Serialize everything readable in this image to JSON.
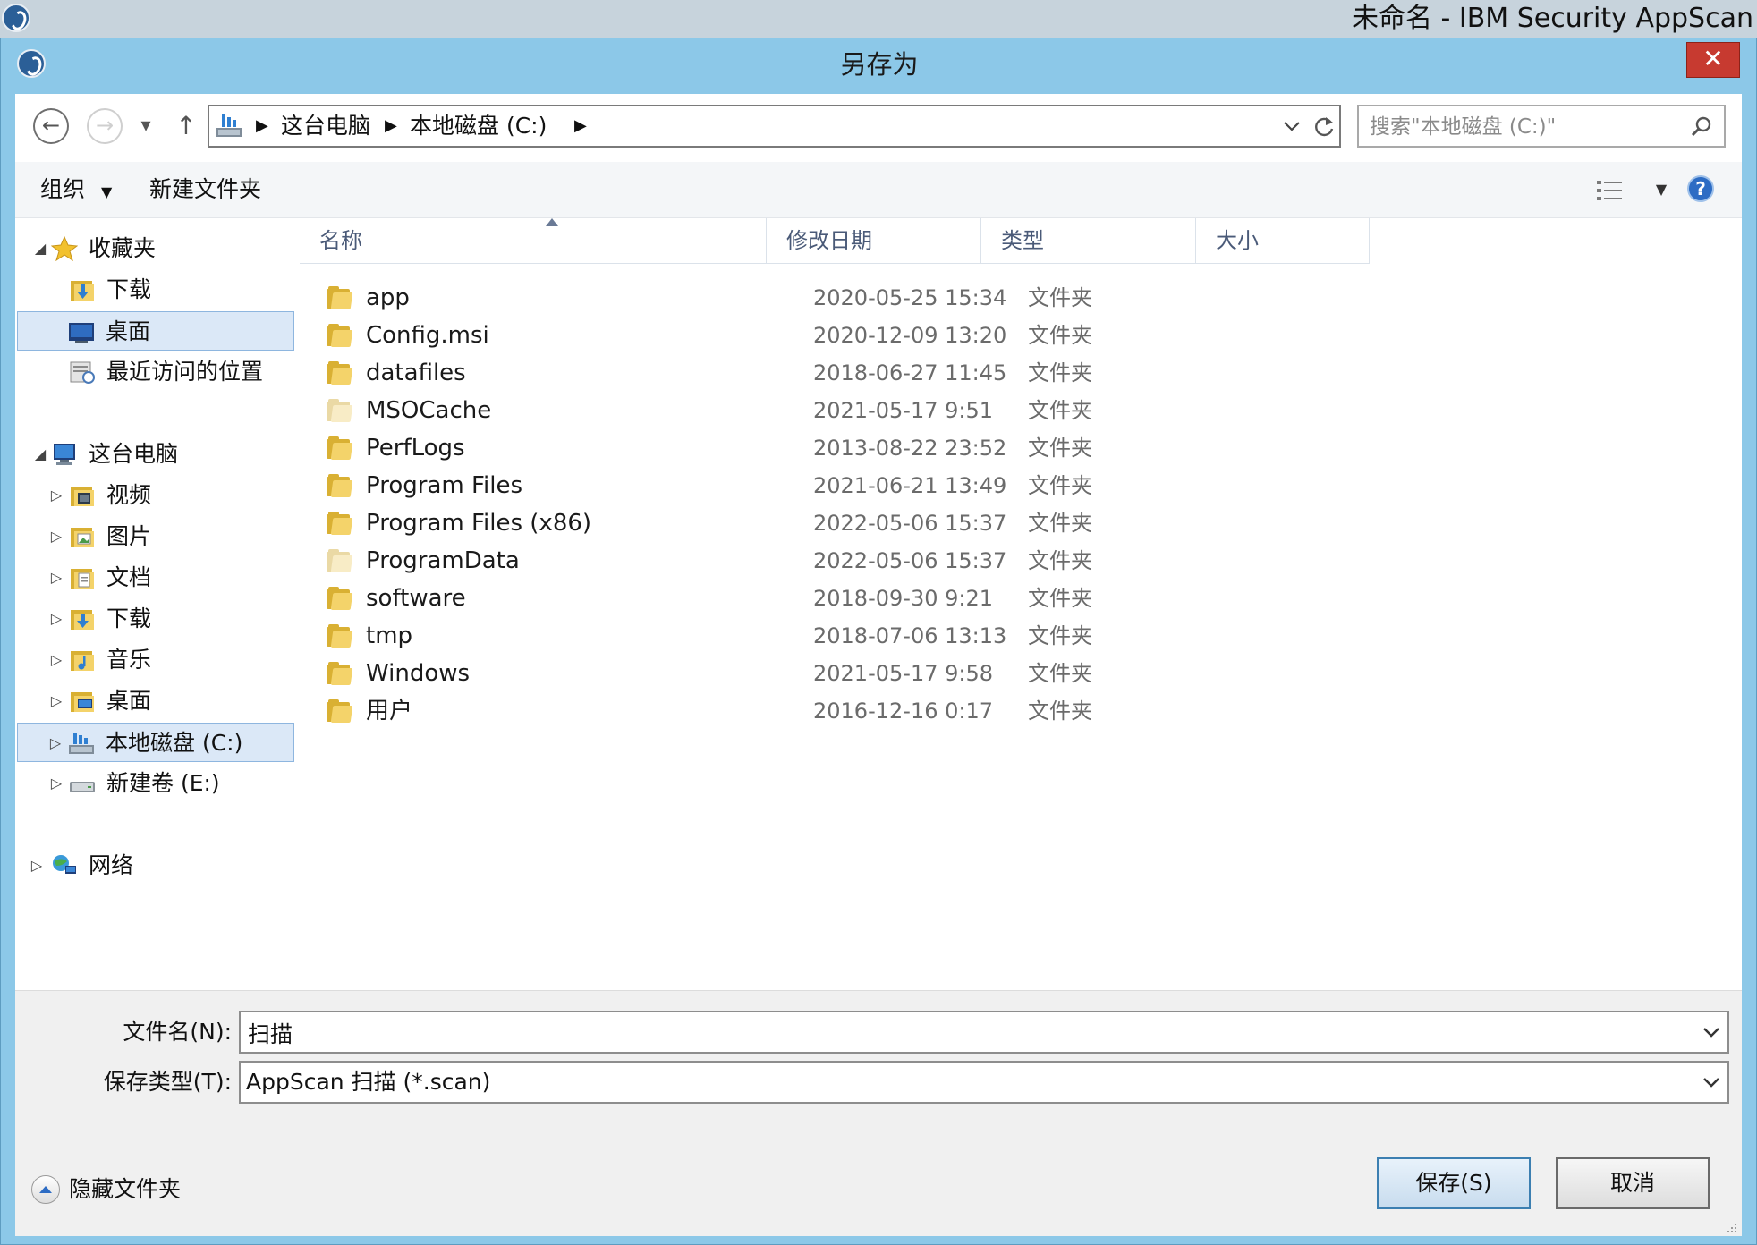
{
  "app": {
    "title": "未命名 - IBM Security AppScan"
  },
  "dialog": {
    "title": "另存为",
    "close_symbol": "✕"
  },
  "address": {
    "crumbs": [
      "这台电脑",
      "本地磁盘 (C:)"
    ],
    "search_placeholder": "搜索\"本地磁盘 (C:)\""
  },
  "toolbar": {
    "organize": "组织",
    "new_folder": "新建文件夹"
  },
  "nav": {
    "favorites": "收藏夹",
    "fav_items": [
      "下载",
      "桌面",
      "最近访问的位置"
    ],
    "this_pc": "这台电脑",
    "pc_items": [
      "视频",
      "图片",
      "文档",
      "下载",
      "音乐",
      "桌面",
      "本地磁盘 (C:)",
      "新建卷 (E:)"
    ],
    "network": "网络"
  },
  "columns": {
    "name": "名称",
    "date": "修改日期",
    "type": "类型",
    "size": "大小"
  },
  "files": [
    {
      "name": "app",
      "date": "2020-05-25 15:34",
      "type": "文件夹"
    },
    {
      "name": "Config.msi",
      "date": "2020-12-09 13:20",
      "type": "文件夹"
    },
    {
      "name": "datafiles",
      "date": "2018-06-27 11:45",
      "type": "文件夹"
    },
    {
      "name": "MSOCache",
      "date": "2021-05-17 9:51",
      "type": "文件夹"
    },
    {
      "name": "PerfLogs",
      "date": "2013-08-22 23:52",
      "type": "文件夹"
    },
    {
      "name": "Program Files",
      "date": "2021-06-21 13:49",
      "type": "文件夹"
    },
    {
      "name": "Program Files (x86)",
      "date": "2022-05-06 15:37",
      "type": "文件夹"
    },
    {
      "name": "ProgramData",
      "date": "2022-05-06 15:37",
      "type": "文件夹"
    },
    {
      "name": "software",
      "date": "2018-09-30 9:21",
      "type": "文件夹"
    },
    {
      "name": "tmp",
      "date": "2018-07-06 13:13",
      "type": "文件夹"
    },
    {
      "name": "Windows",
      "date": "2021-05-17 9:58",
      "type": "文件夹"
    },
    {
      "name": "用户",
      "date": "2016-12-16 0:17",
      "type": "文件夹"
    }
  ],
  "form": {
    "filename_label": "文件名(N):",
    "filename_value": "扫描",
    "filetype_label": "保存类型(T):",
    "filetype_value": "AppScan 扫描 (*.scan)"
  },
  "buttons": {
    "save": "保存(S)",
    "cancel": "取消",
    "hide_folders": "隐藏文件夹"
  }
}
